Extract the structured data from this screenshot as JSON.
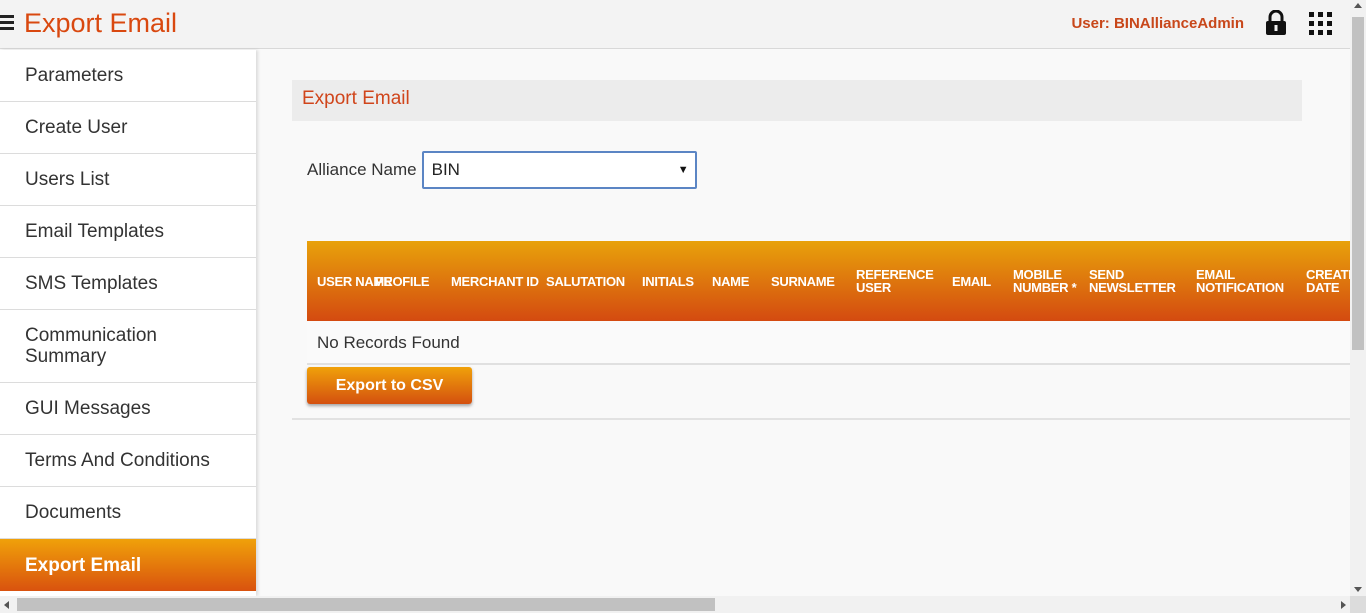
{
  "header": {
    "title": "Export Email",
    "user_label": "User: BINAllianceAdmin",
    "menu_icon": "hamburger-menu-icon",
    "lock_icon": "lock-icon",
    "apps_icon": "apps-grid-icon"
  },
  "sidebar": {
    "items": [
      {
        "label": "Parameters"
      },
      {
        "label": "Create User"
      },
      {
        "label": "Users List"
      },
      {
        "label": "Email Templates"
      },
      {
        "label": "SMS Templates"
      },
      {
        "label": "Communication Summary"
      },
      {
        "label": "GUI Messages"
      },
      {
        "label": "Terms And Conditions"
      },
      {
        "label": "Documents"
      },
      {
        "label": "Export Email",
        "active": true
      }
    ]
  },
  "main": {
    "panel_title": "Export Email",
    "alliance_label": "Alliance Name",
    "alliance_value": "BIN",
    "table": {
      "columns": [
        "USER NAME",
        "PROFILE",
        "MERCHANT ID",
        "SALUTATION",
        "INITIALS",
        "NAME",
        "SURNAME",
        "REFERENCE USER",
        "EMAIL",
        "MOBILE NUMBER *",
        "SEND NEWSLETTER",
        "EMAIL NOTIFICATION",
        "CREATE DATE"
      ],
      "empty_message": "No Records Found"
    },
    "export_button": "Export to CSV"
  },
  "colors": {
    "accent": "#d9480f",
    "header_gradient_top": "#e8a20b",
    "header_gradient_bottom": "#d44a10",
    "select_border": "#5b85c4"
  }
}
